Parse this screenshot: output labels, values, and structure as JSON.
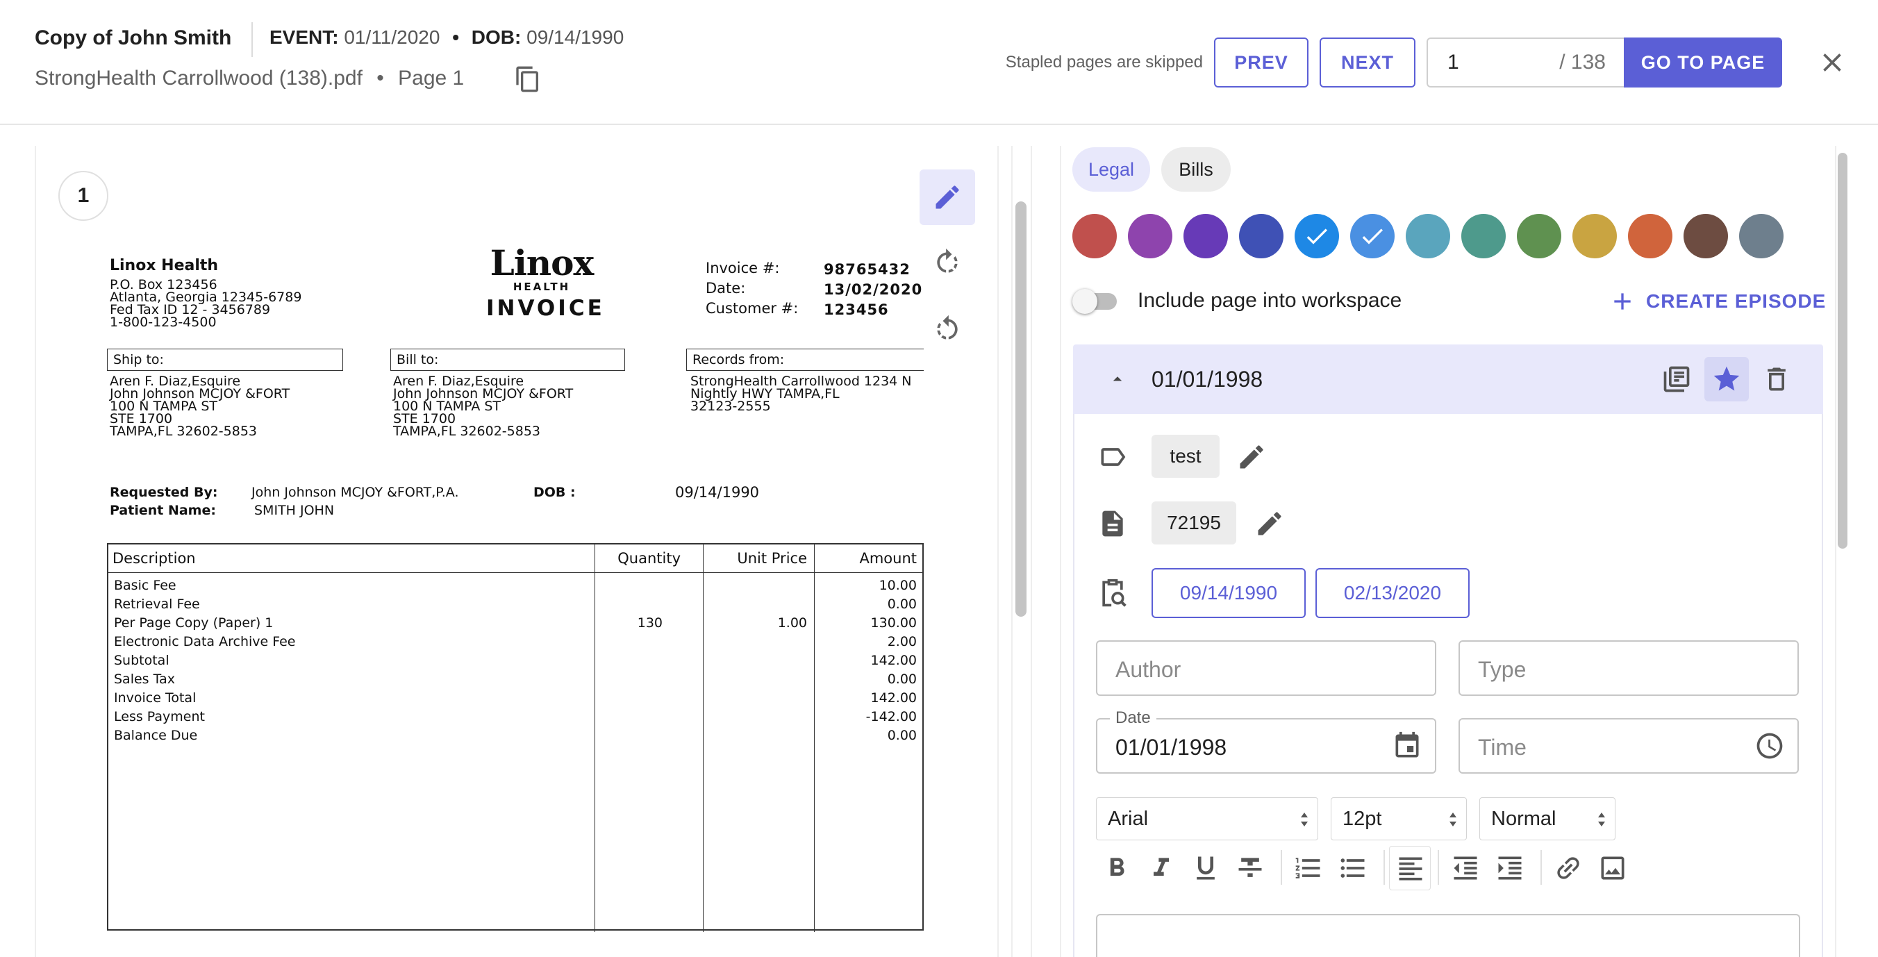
{
  "header": {
    "title": "Copy of John Smith",
    "event_label": "EVENT:",
    "event_value": "01/11/2020",
    "bullet": "•",
    "dob_label": "DOB:",
    "dob_value": "09/14/1990",
    "file_name": "StrongHealth Carrollwood (138).pdf",
    "page_label": "Page 1",
    "stapled_note": "Stapled pages are skipped",
    "prev_label": "PREV",
    "next_label": "NEXT",
    "page_input_value": "1",
    "page_total": "/ 138",
    "goto_label": "GO TO PAGE"
  },
  "document": {
    "page_badge": "1",
    "invoice": {
      "company": "Linox Health",
      "address": [
        "P.O. Box 123456",
        "Atlanta, Georgia 12345-6789",
        "Fed Tax ID 12 - 3456789",
        "1-800-123-4500"
      ],
      "logo_main": "Linox",
      "logo_sub": "HEALTH",
      "logo_doc": "INVOICE",
      "meta_labels": [
        "Invoice #:",
        "Date:",
        "Customer #:"
      ],
      "meta_values": [
        "98765432",
        "13/02/2020",
        "123456"
      ],
      "ship_to_label": "Ship to:",
      "ship_to": [
        "Aren F. Diaz,Esquire",
        "John Johnson  MCJOY &FORT",
        "100 N TAMPA ST",
        "STE 1700",
        "TAMPA,FL 32602-5853"
      ],
      "bill_to_label": "Bill to:",
      "bill_to": [
        "Aren F. Diaz,Esquire",
        "John Johnson  MCJOY &FORT",
        "100 N TAMPA ST",
        "STE 1700",
        "TAMPA,FL 32602-5853"
      ],
      "records_from_label": "Records from:",
      "records_from": [
        "StrongHealth Carrollwood 1234 N",
        "Nightly HWY TAMPA,FL",
        "32123-2555"
      ],
      "requested_by_label": "Requested By:",
      "requested_by": "John Johnson  MCJOY &FORT,P.A.",
      "dob_label": "DOB :",
      "dob": "09/14/1990",
      "patient_label": "Patient Name:",
      "patient": "SMITH JOHN",
      "columns": [
        "Description",
        "Quantity",
        "Unit Price",
        "Amount"
      ],
      "rows": [
        {
          "desc": "Basic Fee",
          "qty": "",
          "price": "",
          "amount": "10.00"
        },
        {
          "desc": "Retrieval Fee",
          "qty": "",
          "price": "",
          "amount": "0.00"
        },
        {
          "desc": "Per Page Copy (Paper) 1",
          "qty": "130",
          "price": "1.00",
          "amount": "130.00"
        },
        {
          "desc": "Electronic Data Archive Fee",
          "qty": "",
          "price": "",
          "amount": "2.00"
        },
        {
          "desc": "Subtotal",
          "qty": "",
          "price": "",
          "amount": "142.00"
        },
        {
          "desc": "Sales Tax",
          "qty": "",
          "price": "",
          "amount": "0.00"
        },
        {
          "desc": "Invoice Total",
          "qty": "",
          "price": "",
          "amount": "142.00"
        },
        {
          "desc": "Less Payment",
          "qty": "",
          "price": "",
          "amount": "-142.00"
        },
        {
          "desc": "Balance Due",
          "qty": "",
          "price": "",
          "amount": "0.00"
        }
      ]
    }
  },
  "panel": {
    "tabs": [
      {
        "label": "Legal",
        "active": true
      },
      {
        "label": "Bills",
        "active": false
      }
    ],
    "colors": [
      {
        "hex": "#c0504d",
        "checked": false
      },
      {
        "hex": "#8e44ad",
        "checked": false
      },
      {
        "hex": "#673ab7",
        "checked": false
      },
      {
        "hex": "#3f51b5",
        "checked": false
      },
      {
        "hex": "#1e88e5",
        "checked": true
      },
      {
        "hex": "#4a90e2",
        "checked": true
      },
      {
        "hex": "#5aa5bd",
        "checked": false
      },
      {
        "hex": "#4e9a8c",
        "checked": false
      },
      {
        "hex": "#5f9150",
        "checked": false
      },
      {
        "hex": "#c9a441",
        "checked": false
      },
      {
        "hex": "#d0643c",
        "checked": false
      },
      {
        "hex": "#6d4c41",
        "checked": false
      },
      {
        "hex": "#6e7f8d",
        "checked": false
      }
    ],
    "include_label": "Include page into workspace",
    "include_on": false,
    "create_episode_label": "CREATE EPISODE",
    "episode": {
      "date": "01/01/1998",
      "tag": "test",
      "code": "72195",
      "date_buttons": [
        "09/14/1990",
        "02/13/2020"
      ],
      "author_placeholder": "Author",
      "type_placeholder": "Type",
      "date_label": "Date",
      "date_value": "01/01/1998",
      "time_placeholder": "Time",
      "font_select": "Arial",
      "size_select": "12pt",
      "style_select": "Normal"
    }
  },
  "colors": {
    "accent": "#5b5fd6",
    "accent_light": "#e8e8fb"
  }
}
